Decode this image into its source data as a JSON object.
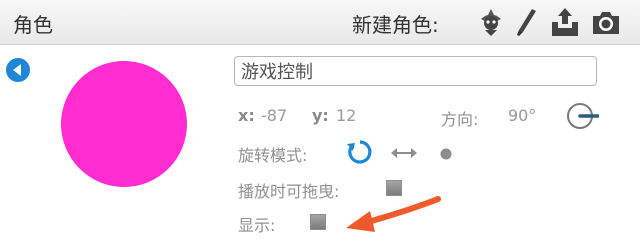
{
  "header": {
    "title": "角色",
    "new_sprite_label": "新建角色:",
    "icons": [
      "sprite-library-icon",
      "paint-brush-icon",
      "upload-icon",
      "camera-icon"
    ]
  },
  "sprite": {
    "name": "游戏控制",
    "x_label": "x:",
    "x_value": "-87",
    "y_label": "y:",
    "y_value": "12",
    "direction_label": "方向:",
    "direction_value": "90°",
    "rotation_label": "旋转模式:",
    "draggable_label": "播放时可拖曳:",
    "show_label": "显示:",
    "costume_color": "#ff2ccf"
  },
  "colors": {
    "accent_blue": "#1e88d6",
    "annotation_arrow": "#f05a2a"
  }
}
